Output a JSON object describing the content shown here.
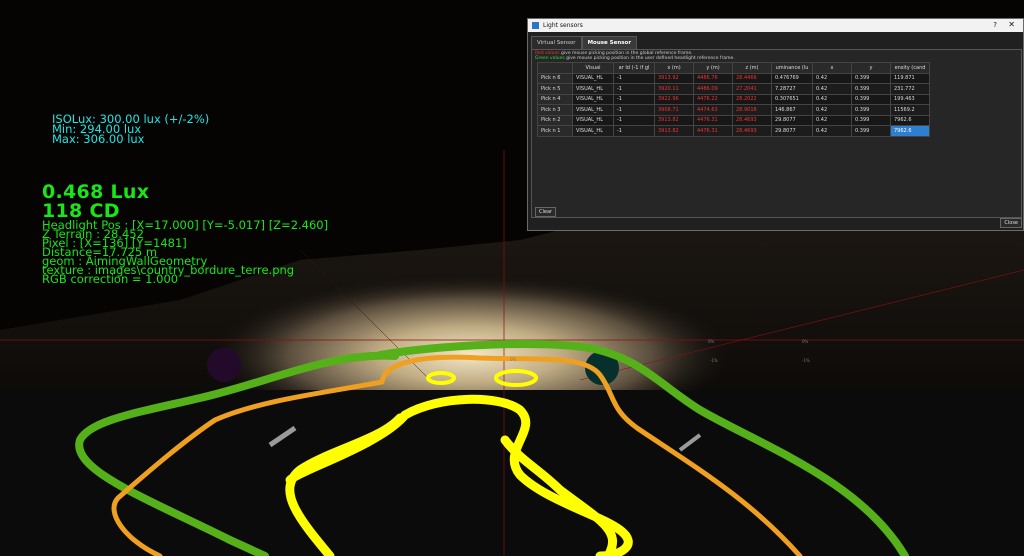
{
  "colors": {
    "hud_green": "#19e619",
    "hud_cyan": "#1fe6e6",
    "iso_green": "#56b01a",
    "iso_orange": "#f0a020",
    "iso_yellow": "#ffff00",
    "selection_blue": "#2f7fd0"
  },
  "iso_overlay": {
    "line1": "ISOLux: 300.00 lux (+/-2%)",
    "line2": "Min: 294.00 lux",
    "line3": "Max: 306.00 lux"
  },
  "hud": {
    "lux": "0.468 Lux",
    "cd": "118 CD",
    "headlight_pos": "Headlight Pos : [X=17.000] [Y=-5.017] [Z=2.460]",
    "z_terrain": "Z Terrain : 28.452",
    "pixel": "Pixel : [X=136] [Y=1481]",
    "distance": "Distance=17.725 m",
    "geom": "geom : AimingWallGeometry",
    "texture": "texture : images\\country_bordure_terre.png",
    "rgb": "RGB correction = 1.000"
  },
  "scene_marks": {
    "m1": "0%",
    "m2": "-1%",
    "m3": "0%",
    "m4": "-1%",
    "m5": "0%"
  },
  "dialog": {
    "title": "Light sensors",
    "help": "?",
    "close_x": "✕",
    "tabs": [
      "Virtual Sensor",
      "Mouse Sensor"
    ],
    "note_red_prefix": "Red values",
    "note_red_text": " give mouse picking position in the global reference frame.",
    "note_green_prefix": "Green values",
    "note_green_text": " give mouse picking position in the user defined headlight reference frame.",
    "columns": [
      "",
      "Visual",
      "ar Id (-1 if gl",
      "x (m)",
      "y (m)",
      "z (m)",
      "uminance (lu",
      "x",
      "y",
      "ensity (cand"
    ],
    "rows": [
      [
        "Pick n 6",
        "VISUAL_HL",
        "-1",
        "3913.92",
        "4486.76",
        "28.4466",
        "0.476769",
        "0.42",
        "0.399",
        "119.871"
      ],
      [
        "Pick n 5",
        "VISUAL_HL",
        "-1",
        "3920.11",
        "4486.09",
        "27.2041",
        "7.28727",
        "0.42",
        "0.399",
        "231.772"
      ],
      [
        "Pick n 4",
        "VISUAL_HL",
        "-1",
        "3922.96",
        "4476.22",
        "28.2022",
        "0.307651",
        "0.42",
        "0.399",
        "199.463"
      ],
      [
        "Pick n 3",
        "VISUAL_HL",
        "-1",
        "3908.71",
        "4474.63",
        "28.9018",
        "146.867",
        "0.42",
        "0.399",
        "11569.2"
      ],
      [
        "Pick n 2",
        "VISUAL_HL",
        "-1",
        "3913.82",
        "4476.31",
        "28.4693",
        "29.8077",
        "0.42",
        "0.399",
        "7962.6"
      ],
      [
        "Pick n 1",
        "VISUAL_HL",
        "-1",
        "3913.82",
        "4476.31",
        "28.4693",
        "29.8077",
        "0.42",
        "0.399",
        "7962.6"
      ]
    ],
    "clear_label": "Clear",
    "close_label": "Close"
  }
}
